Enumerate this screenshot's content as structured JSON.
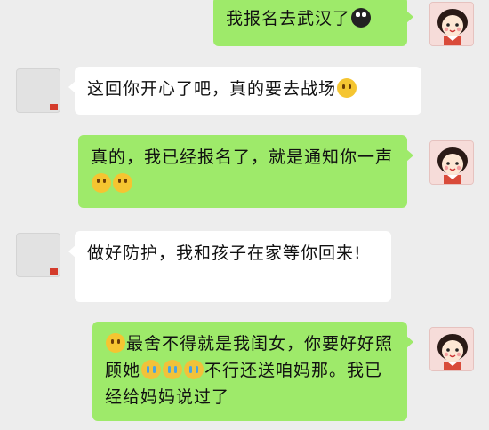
{
  "messages": [
    {
      "side": "self",
      "parts": [
        {
          "t": "我报名去武汉了"
        },
        {
          "e": "penguin"
        }
      ]
    },
    {
      "side": "other",
      "parts": [
        {
          "t": "这回你开心了吧，真的要去战场"
        },
        {
          "e": "hug"
        }
      ]
    },
    {
      "side": "self",
      "parts": [
        {
          "t": "真的，我已经报名了，就是通知你一声"
        },
        {
          "e": "happy"
        },
        {
          "e": "happy"
        }
      ]
    },
    {
      "side": "other",
      "parts": [
        {
          "t": "做好防护，我和孩子在家等你回来!"
        }
      ]
    },
    {
      "side": "self",
      "parts": [
        {
          "e": "hug"
        },
        {
          "t": "最舍不得就是我闺女，你要好好照顾她"
        },
        {
          "e": "cry"
        },
        {
          "e": "cry"
        },
        {
          "e": "cry"
        },
        {
          "t": "不行还送咱妈那。我已经给妈妈说过了"
        }
      ]
    }
  ]
}
